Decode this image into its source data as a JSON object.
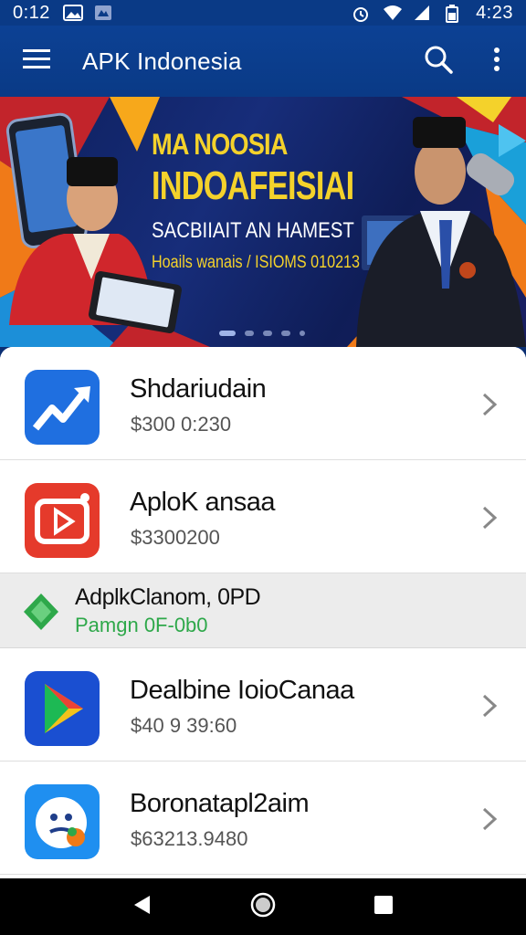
{
  "status_bar": {
    "left_time": "0:12",
    "right_time": "4:23",
    "icons_left": [
      "gallery-icon",
      "app-icon"
    ],
    "icons_right": [
      "alarm-icon",
      "wifi-icon",
      "signal-icon",
      "battery-icon"
    ]
  },
  "appbar": {
    "title": "APK Indonesia",
    "icons": [
      "menu-icon",
      "search-icon",
      "more-vert-icon"
    ]
  },
  "banner": {
    "line1": "MA NOOSIA",
    "line2": "INDOAFEISIAI",
    "line3": "SACBIIAIT AN HAMEST",
    "line4": "Hoails wanais / ISIOMS 010213",
    "page_count": 5,
    "active_page": 0
  },
  "apps": [
    {
      "name": "Shdariudain",
      "price": "$300 0:230",
      "icon": "trending-chart-icon",
      "color": "#1f6fe0"
    },
    {
      "name": "AploK ansaa",
      "price": "$3300200",
      "icon": "video-play-icon",
      "color": "#e53a2b"
    },
    {
      "name": "Dealbine IoioCanaa",
      "price": "$40 9 39:60",
      "icon": "play-store-icon",
      "color": "#1a4fd1"
    },
    {
      "name": "Boronatapl2aim",
      "price": "$63213.9480",
      "icon": "face-bubble-icon",
      "color": "#1f8ff0"
    }
  ],
  "promo": {
    "name": "AdplkClanom, 0PD",
    "subtitle": "Pamgn 0F-0b0",
    "icon": "green-diamond-icon",
    "accent": "#2ea84a"
  },
  "navbar": {
    "icons": [
      "back-icon",
      "home-icon",
      "recents-icon"
    ]
  }
}
